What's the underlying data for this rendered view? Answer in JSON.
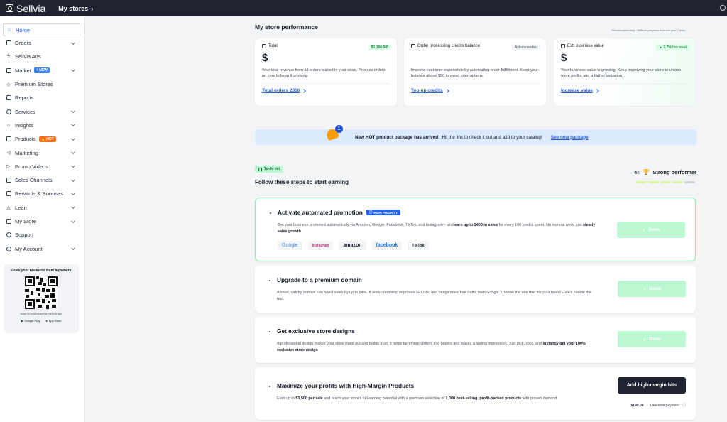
{
  "topbar": {
    "logo_text": "Sellvia",
    "mystores_label": "My stores"
  },
  "sidebar": {
    "items": [
      {
        "label": "Home",
        "icon": "home-icon"
      },
      {
        "label": "Orders",
        "icon": "orders-icon"
      },
      {
        "label": "Sellvia Ads",
        "icon": "ads-icon"
      },
      {
        "label": "Market",
        "icon": "market-icon",
        "badge": "+ NEW"
      },
      {
        "label": "Premium Stores",
        "icon": "tag-icon"
      },
      {
        "label": "Reports",
        "icon": "reports-icon"
      },
      {
        "label": "Services",
        "icon": "services-icon"
      },
      {
        "label": "Insights",
        "icon": "bulb-icon"
      },
      {
        "label": "Products",
        "icon": "products-icon",
        "badge": "🔥 HOT"
      },
      {
        "label": "Marketing",
        "icon": "megaphone-icon"
      },
      {
        "label": "Promo Videos",
        "icon": "video-icon"
      },
      {
        "label": "Sales Channels",
        "icon": "channels-icon"
      },
      {
        "label": "Rewards & Bonuses",
        "icon": "gift-icon"
      },
      {
        "label": "Learn",
        "icon": "graduation-icon"
      },
      {
        "label": "My Store",
        "icon": "store-icon"
      },
      {
        "label": "Support",
        "icon": "chat-icon"
      },
      {
        "label": "My Account",
        "icon": "user-icon"
      }
    ],
    "app_card": {
      "title": "Grow your business from anywhere",
      "subtitle": "Scan to download the Sellvia app",
      "google_play": "Google Play",
      "app_store": "App Store"
    }
  },
  "performance": {
    "title": "My store performance",
    "note": "*Recalculated daily. Reflects progress from the past 7 days",
    "total": {
      "label": "Total",
      "delta": "$1,160.58*",
      "value": "$",
      "desc": "Your total revenue from all orders placed in your store. Process orders on time to keep it growing.",
      "link": "Total orders 2016"
    },
    "credits": {
      "label": "Order processing credits balance",
      "status": "Action needed",
      "value": "",
      "desc": "Improve customer experience by automating order fulfillment. Keep your balance above $50 to avoid interruptions.",
      "link": "Top-up credits"
    },
    "valuation": {
      "label": "Est. business value",
      "delta": "▲ 2.7%",
      "delta_suffix": "this week",
      "value": "$",
      "desc": "Your business value is growing. Keep improving your store to unlock more profits and a higher valuation.",
      "link": "Increase value"
    }
  },
  "banner": {
    "badge_count": "1",
    "bold_text": "New HOT product package has arrived!",
    "text": "Hit the link to check it out and add to your catalog!",
    "link": "See new package"
  },
  "todo": {
    "badge": "To-do list",
    "title": "Follow these steps to start earning",
    "progress_num": "4",
    "progress_den": "/5",
    "progress_label": "Strong performer",
    "progress_done": 4,
    "progress_total": 5
  },
  "tasks": [
    {
      "title": "Activate automated promotion",
      "badge": "HIGH PRIORITY",
      "desc_a": "Get your business promoted automatically via Amazon, Google, Facebook, TikTok, and Instagram – and ",
      "desc_b": "earn up to $400 in sales",
      "desc_c": " for every 100 credits spent. No manual work, just ",
      "desc_d": "steady sales growth",
      "button": "Done",
      "logos": [
        "Google",
        "Instagram",
        "amazon",
        "facebook",
        "TikTok"
      ]
    },
    {
      "title": "Upgrade to a premium domain",
      "desc": "A short, catchy domain can boost sales by up to 84%. It adds credibility, improves SEO 3x, and brings more free traffic from Google. Choose the one that fits your brand – we'll handle the rest.",
      "button": "Done"
    },
    {
      "title": "Get exclusive store designs",
      "desc_a": "A professional design makes your store stand out and builds trust. It helps turn more visitors into buyers and leaves a lasting impression. Just pick, click, and ",
      "desc_b": "instantly get your 100% exclusive store design",
      "button": "Done"
    },
    {
      "title": "Maximize your profits with High-Margin Products",
      "desc_a": "Earn up to ",
      "desc_b": "$3,500 per sale",
      "desc_c": " and reach your store's full earning potential with a premium selection of ",
      "desc_d": "1,000 best-selling, profit-packed products",
      "desc_e": " with proven demand",
      "button": "Add high-margin hits",
      "price": "$199.00",
      "price_note": "One-time payment"
    }
  ]
}
